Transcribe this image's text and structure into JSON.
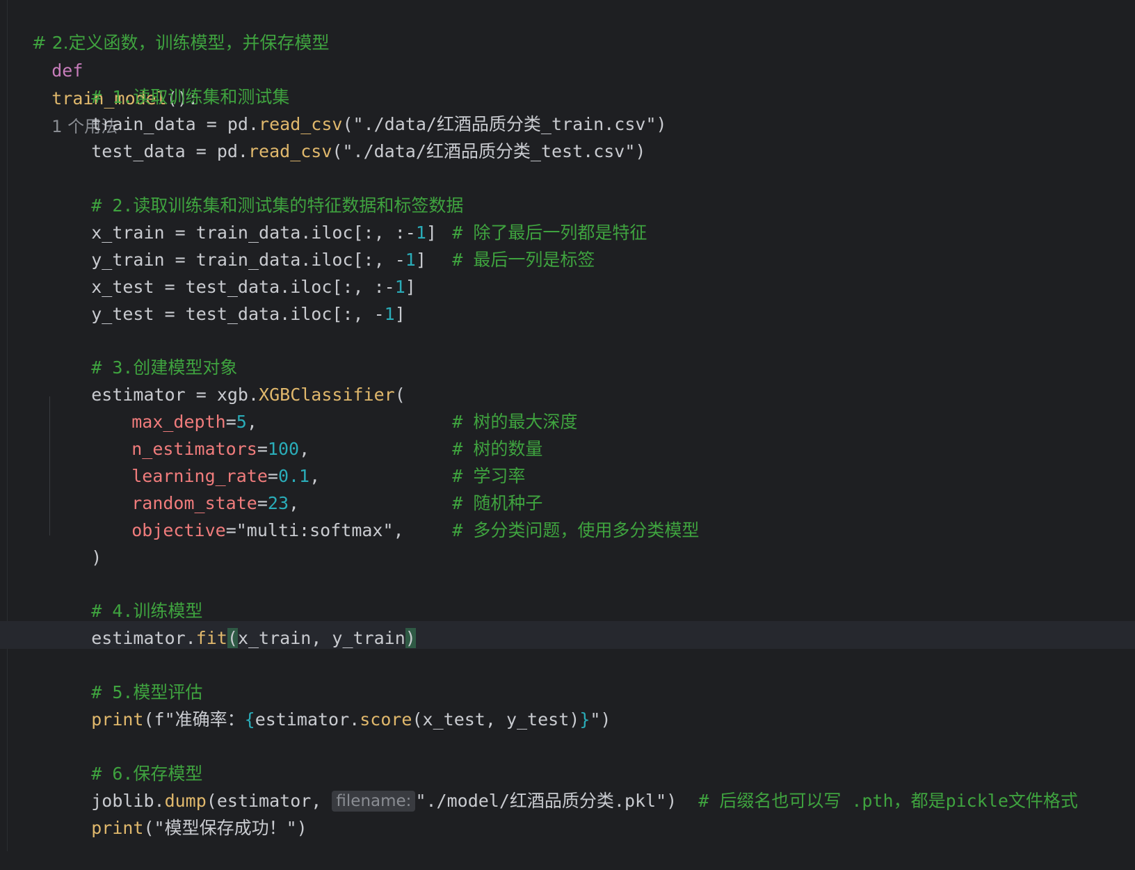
{
  "editor": {
    "usage_hint": "1 个用法",
    "filename_hint": "filename:",
    "lines": {
      "l1_comment": "# 2.定义函数，训练模型，并保存模型",
      "l2_def": "def",
      "l2_name": "train_model",
      "l2_tail": "():",
      "l3_comment": "# 1.读取训练集和测试集",
      "l4_var": "train_data = pd.",
      "l4_fn": "read_csv",
      "l4_arg": "(\"./data/红酒品质分类_train.csv\")",
      "l5_var": "test_data = pd.",
      "l5_fn": "read_csv",
      "l5_arg": "(\"./data/红酒品质分类_test.csv\")",
      "l6_comment": "# 2.读取训练集和测试集的特征数据和标签数据",
      "l7_code_a": "x_train = train_data.iloc[:, :-",
      "l7_num": "1",
      "l7_code_b": "]",
      "l7_comment": "# 除了最后一列都是特征",
      "l8_code_a": "y_train = train_data.iloc[:, -",
      "l8_num": "1",
      "l8_code_b": "]",
      "l8_comment": "# 最后一列是标签",
      "l9_code_a": "x_test = test_data.iloc[:, :-",
      "l9_num": "1",
      "l9_code_b": "]",
      "l10_code_a": "y_test = test_data.iloc[:, -",
      "l10_num": "1",
      "l10_code_b": "]",
      "l11_comment": "# 3.创建模型对象",
      "l12_var": "estimator = xgb.",
      "l12_fn": "XGBClassifier",
      "l12_tail": "(",
      "p1_name": "max_depth",
      "p1_eq": "=",
      "p1_val": "5",
      "p1_comma": ",",
      "p1_comment": "# 树的最大深度",
      "p2_name": "n_estimators",
      "p2_eq": "=",
      "p2_val": "100",
      "p2_comma": ",",
      "p2_comment": "# 树的数量",
      "p3_name": "learning_rate",
      "p3_eq": "=",
      "p3_val": "0.1",
      "p3_comma": ",",
      "p3_comment": "# 学习率",
      "p4_name": "random_state",
      "p4_eq": "=",
      "p4_val": "23",
      "p4_comma": ",",
      "p4_comment": "# 随机种子",
      "p5_name": "objective",
      "p5_eq": "=",
      "p5_val": "\"multi:softmax\"",
      "p5_comma": ",",
      "p5_comment": "# 多分类问题，使用多分类模型",
      "l13_close": ")",
      "l14_comment": "# 4.训练模型",
      "l15_var": "estimator.",
      "l15_fn": "fit",
      "l15_open": "(",
      "l15_args": "x_train, y_train",
      "l15_close": ")",
      "l16_comment": "# 5.模型评估",
      "l17_fn": "print",
      "l17_a": "(f\"准确率：",
      "l17_brace_open": "{",
      "l17_b": "estimator.",
      "l17_fn2": "score",
      "l17_c": "(x_test, y_test)",
      "l17_brace_close": "}",
      "l17_d": "\")",
      "l18_comment": "# 6.保存模型",
      "l19_var": "joblib.",
      "l19_fn": "dump",
      "l19_a": "(estimator, ",
      "l19_str": "\"./model/红酒品质分类.pkl\")",
      "l19_comment": "# 后缀名也可以写 .pth，都是pickle文件格式",
      "l20_fn": "print",
      "l20_a": "(\"模型保存成功！\")"
    }
  }
}
